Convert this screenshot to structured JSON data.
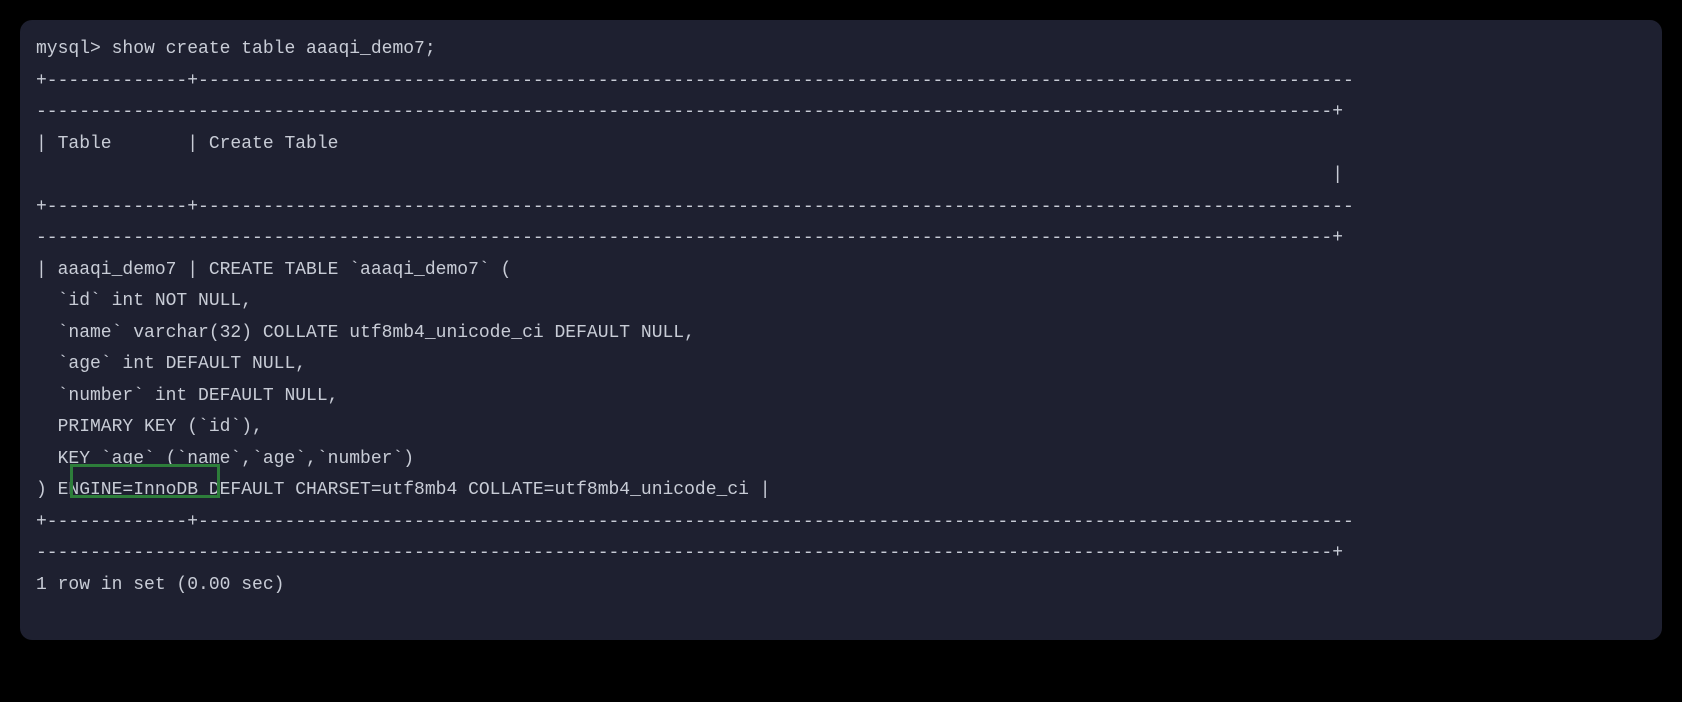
{
  "terminal": {
    "lines": [
      "mysql> show create table aaaqi_demo7;",
      "+-------------+-----------------------------------------------------------------------------------------------------------",
      "------------------------------------------------------------------------------------------------------------------------+",
      "| Table       | Create Table",
      "                                                                                                                        |",
      "+-------------+-----------------------------------------------------------------------------------------------------------",
      "------------------------------------------------------------------------------------------------------------------------+",
      "| aaaqi_demo7 | CREATE TABLE `aaaqi_demo7` (",
      "  `id` int NOT NULL,",
      "  `name` varchar(32) COLLATE utf8mb4_unicode_ci DEFAULT NULL,",
      "  `age` int DEFAULT NULL,",
      "  `number` int DEFAULT NULL,",
      "  PRIMARY KEY (`id`),",
      "  KEY `age` (`name`,`age`,`number`)",
      ") ENGINE=InnoDB DEFAULT CHARSET=utf8mb4 COLLATE=utf8mb4_unicode_ci |",
      "+-------------+-----------------------------------------------------------------------------------------------------------",
      "------------------------------------------------------------------------------------------------------------------------+",
      "1 row in set (0.00 sec)"
    ]
  }
}
